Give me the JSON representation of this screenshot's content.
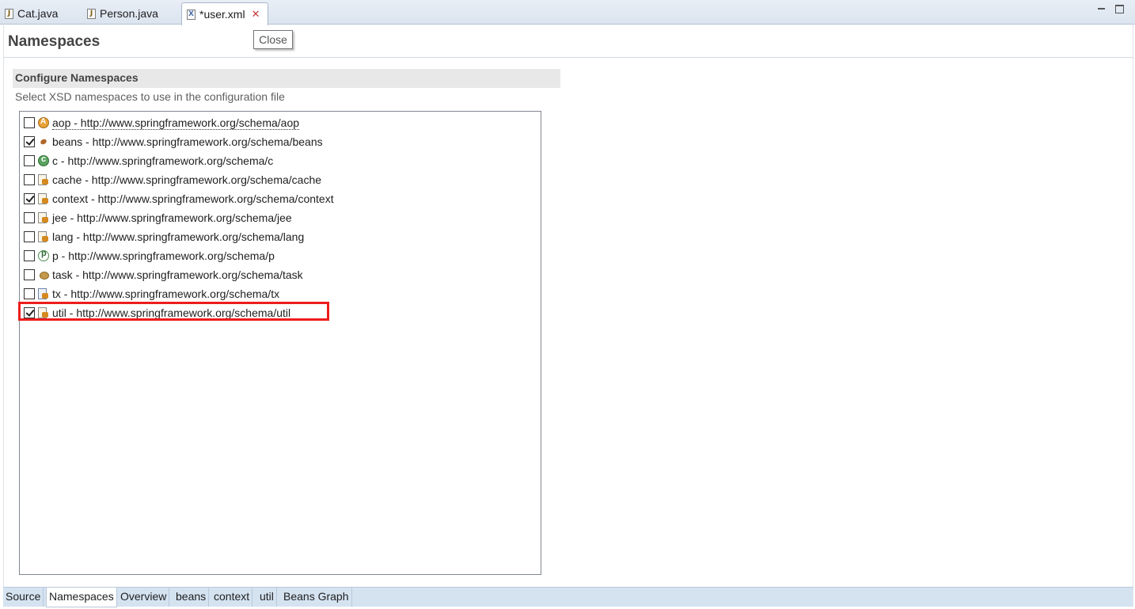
{
  "editor_tabs": [
    {
      "label": "Cat.java",
      "icon": "java-file-icon",
      "active": false
    },
    {
      "label": "Person.java",
      "icon": "java-file-icon",
      "active": false
    },
    {
      "label": "*user.xml",
      "icon": "xml-file-icon",
      "active": true,
      "closable": true
    }
  ],
  "tooltip": "Close",
  "page": {
    "title": "Namespaces"
  },
  "section": {
    "title": "Configure Namespaces",
    "description": "Select XSD namespaces to use in the configuration file"
  },
  "namespaces": [
    {
      "label": "aop - http://www.springframework.org/schema/aop",
      "checked": false,
      "icon": "aop-icon"
    },
    {
      "label": "beans - http://www.springframework.org/schema/beans",
      "checked": true,
      "icon": "bean-icon"
    },
    {
      "label": "c - http://www.springframework.org/schema/c",
      "checked": false,
      "icon": "c-namespace-icon"
    },
    {
      "label": "cache - http://www.springframework.org/schema/cache",
      "checked": false,
      "icon": "xsd-doc-icon"
    },
    {
      "label": "context - http://www.springframework.org/schema/context",
      "checked": true,
      "icon": "xsd-doc-icon"
    },
    {
      "label": "jee - http://www.springframework.org/schema/jee",
      "checked": false,
      "icon": "xsd-doc-icon"
    },
    {
      "label": "lang - http://www.springframework.org/schema/lang",
      "checked": false,
      "icon": "xsd-doc-icon"
    },
    {
      "label": "p - http://www.springframework.org/schema/p",
      "checked": false,
      "icon": "p-namespace-icon"
    },
    {
      "label": "task - http://www.springframework.org/schema/task",
      "checked": false,
      "icon": "task-icon"
    },
    {
      "label": "tx - http://www.springframework.org/schema/tx",
      "checked": false,
      "icon": "tx-icon"
    },
    {
      "label": "util - http://www.springframework.org/schema/util",
      "checked": true,
      "icon": "xsd-doc-icon",
      "highlighted": true
    }
  ],
  "bottom_tabs": [
    "Source",
    "Namespaces",
    "Overview",
    "beans",
    "context",
    "util",
    "Beans Graph"
  ],
  "bottom_active": "Namespaces",
  "colors": {
    "highlight": "#ee1c1c",
    "tab_bar": "#dbe4ef",
    "bottom_bar": "#d5e3f1"
  }
}
